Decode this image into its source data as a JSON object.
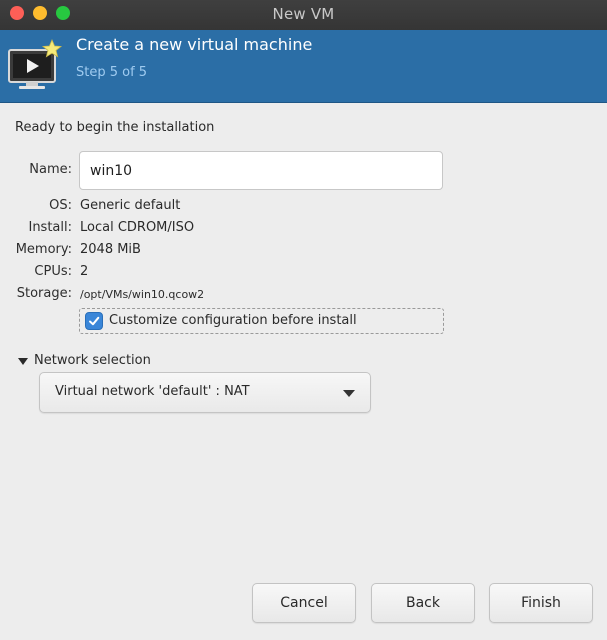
{
  "window": {
    "title": "New VM"
  },
  "header": {
    "title": "Create a new virtual machine",
    "step": "Step 5 of 5",
    "icon": "vm-monitor-star-icon",
    "background_color": "#2b6ea6"
  },
  "summary": {
    "heading": "Ready to begin the installation",
    "name_label": "Name:",
    "name_value": "win10",
    "os_label": "OS:",
    "os_value": "Generic default",
    "install_label": "Install:",
    "install_value": "Local CDROM/ISO",
    "memory_label": "Memory:",
    "memory_value": "2048 MiB",
    "cpus_label": "CPUs:",
    "cpus_value": "2",
    "storage_label": "Storage:",
    "storage_value": "/opt/VMs/win10.qcow2",
    "customize_label": "Customize configuration before install",
    "customize_checked": true
  },
  "network": {
    "section_label": "Network selection",
    "expanded": true,
    "selected": "Virtual network 'default' : NAT"
  },
  "buttons": {
    "cancel": "Cancel",
    "back": "Back",
    "finish": "Finish"
  }
}
